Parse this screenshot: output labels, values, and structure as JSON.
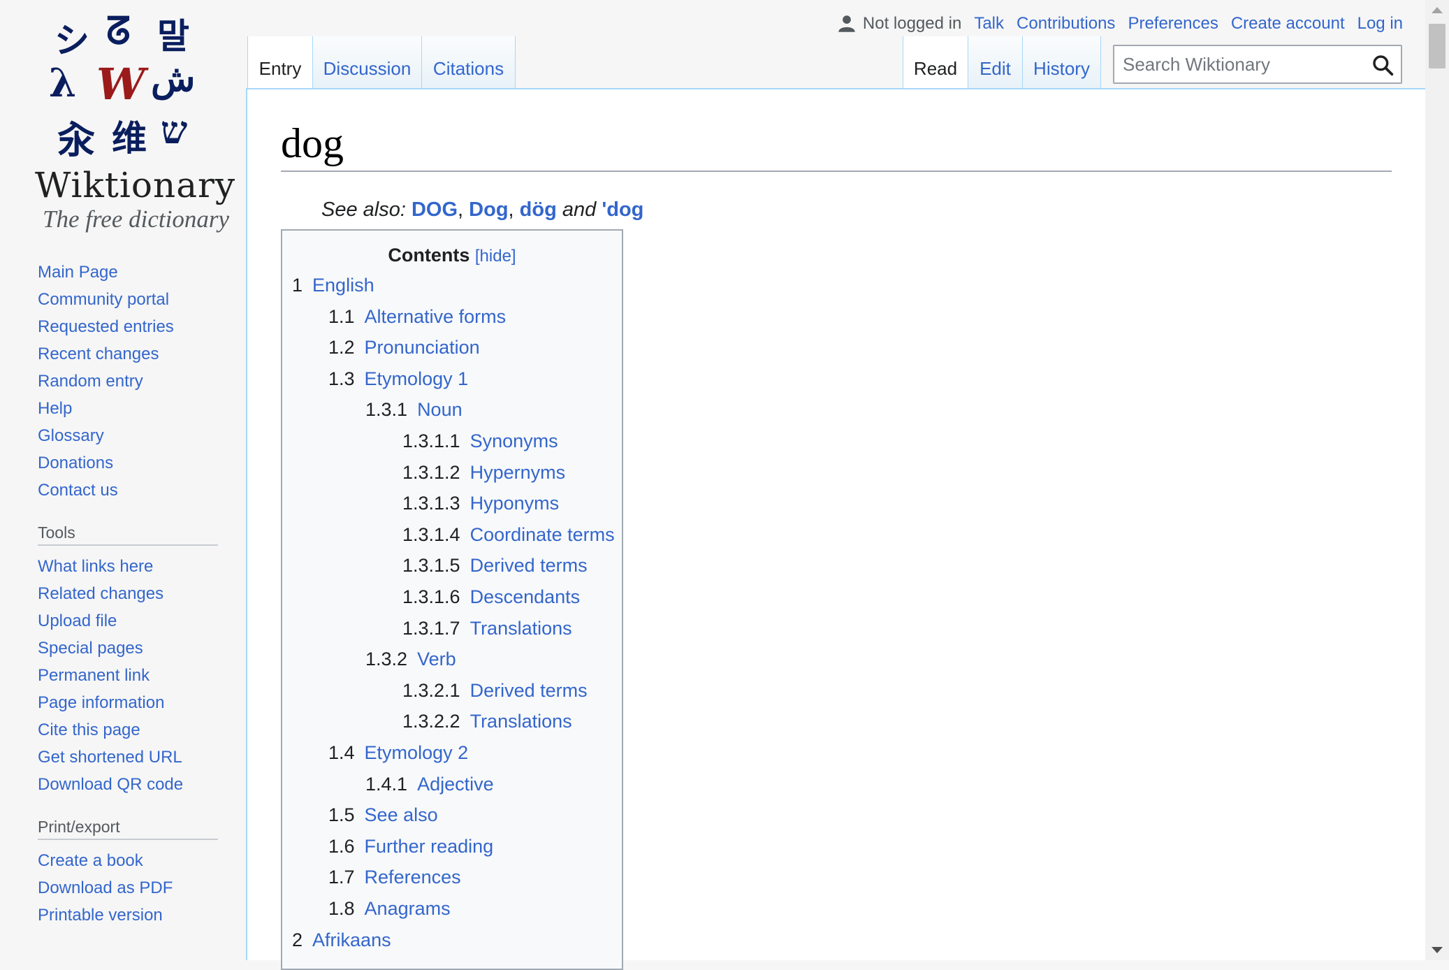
{
  "logo": {
    "glyphs": [
      "シ",
      "ᘔ",
      "말",
      "λ",
      "W",
      "ش",
      "汆",
      "维",
      "ש"
    ],
    "wordmark": "Wiktionary",
    "tagline": "The free dictionary"
  },
  "sidebar": {
    "navigation": [
      "Main Page",
      "Community portal",
      "Requested entries",
      "Recent changes",
      "Random entry",
      "Help",
      "Glossary",
      "Donations",
      "Contact us"
    ],
    "tools_heading": "Tools",
    "tools": [
      "What links here",
      "Related changes",
      "Upload file",
      "Special pages",
      "Permanent link",
      "Page information",
      "Cite this page",
      "Get shortened URL",
      "Download QR code"
    ],
    "print_heading": "Print/export",
    "print": [
      "Create a book",
      "Download as PDF",
      "Printable version"
    ]
  },
  "personal": {
    "not_logged_in": "Not logged in",
    "talk": "Talk",
    "contributions": "Contributions",
    "preferences": "Preferences",
    "create_account": "Create account",
    "log_in": "Log in"
  },
  "tabs": {
    "entry": "Entry",
    "discussion": "Discussion",
    "citations": "Citations",
    "read": "Read",
    "edit": "Edit",
    "history": "History"
  },
  "search": {
    "placeholder": "Search Wiktionary"
  },
  "page": {
    "title": "dog",
    "see_also_prefix": "See also: ",
    "see_also": [
      "DOG",
      "Dog",
      "dög",
      "'dog"
    ],
    "see_also_and": " and "
  },
  "toc": {
    "title": "Contents",
    "toggle": "[hide]",
    "entries": [
      {
        "num": "1",
        "text": "English",
        "level": 1
      },
      {
        "num": "1.1",
        "text": "Alternative forms",
        "level": 2
      },
      {
        "num": "1.2",
        "text": "Pronunciation",
        "level": 2
      },
      {
        "num": "1.3",
        "text": "Etymology 1",
        "level": 2
      },
      {
        "num": "1.3.1",
        "text": "Noun",
        "level": 3
      },
      {
        "num": "1.3.1.1",
        "text": "Synonyms",
        "level": 4
      },
      {
        "num": "1.3.1.2",
        "text": "Hypernyms",
        "level": 4
      },
      {
        "num": "1.3.1.3",
        "text": "Hyponyms",
        "level": 4
      },
      {
        "num": "1.3.1.4",
        "text": "Coordinate terms",
        "level": 4
      },
      {
        "num": "1.3.1.5",
        "text": "Derived terms",
        "level": 4
      },
      {
        "num": "1.3.1.6",
        "text": "Descendants",
        "level": 4
      },
      {
        "num": "1.3.1.7",
        "text": "Translations",
        "level": 4
      },
      {
        "num": "1.3.2",
        "text": "Verb",
        "level": 3
      },
      {
        "num": "1.3.2.1",
        "text": "Derived terms",
        "level": 4
      },
      {
        "num": "1.3.2.2",
        "text": "Translations",
        "level": 4
      },
      {
        "num": "1.4",
        "text": "Etymology 2",
        "level": 2
      },
      {
        "num": "1.4.1",
        "text": "Adjective",
        "level": 3
      },
      {
        "num": "1.5",
        "text": "See also",
        "level": 2
      },
      {
        "num": "1.6",
        "text": "Further reading",
        "level": 2
      },
      {
        "num": "1.7",
        "text": "References",
        "level": 2
      },
      {
        "num": "1.8",
        "text": "Anagrams",
        "level": 2
      },
      {
        "num": "2",
        "text": "Afrikaans",
        "level": 1
      }
    ]
  },
  "colors": {
    "link": "#3366cc",
    "border": "#a7d7f9",
    "logo_red": "#9b1b1b"
  }
}
